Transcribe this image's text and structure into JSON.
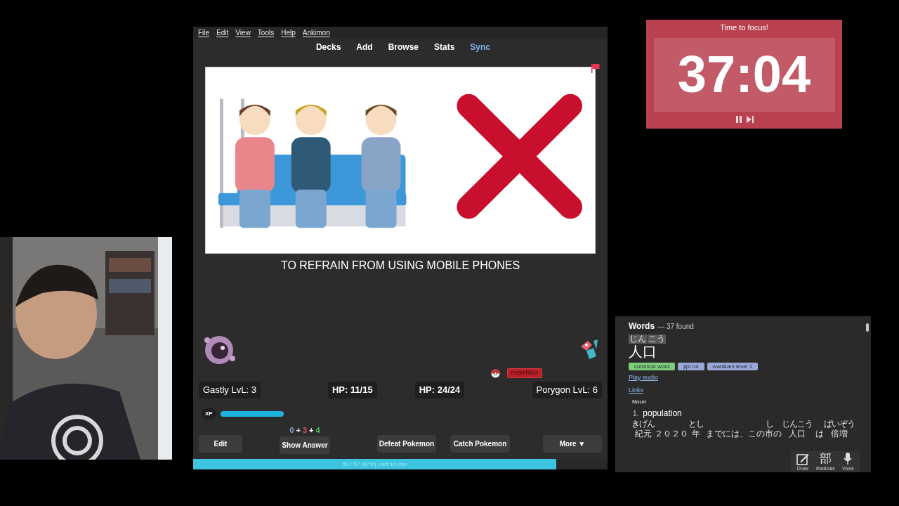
{
  "anki": {
    "menu": [
      "File",
      "Edit",
      "View",
      "Tools",
      "Help",
      "Ankimon"
    ],
    "toolbar": [
      {
        "label": "Decks",
        "highlighted": false
      },
      {
        "label": "Add",
        "highlighted": false
      },
      {
        "label": "Browse",
        "highlighted": false
      },
      {
        "label": "Stats",
        "highlighted": false
      },
      {
        "label": "Sync",
        "highlighted": true
      }
    ],
    "card": {
      "kind": "picture",
      "flagged": true,
      "answer": "TO REFRAIN FROM USING MOBILE PHONES"
    },
    "battle": {
      "player": {
        "name_level": "Gastly LvL: 3",
        "hp": "HP: 11/15"
      },
      "enemy": {
        "hp": "HP: 24/24",
        "name_level": "Porygon LvL: 6",
        "type": "FIGHTING"
      },
      "xp": {
        "label": "XP",
        "level": 0.3
      }
    },
    "counts": {
      "separator": "+",
      "items": [
        {
          "value": "0",
          "color": "#7fa6e0"
        },
        {
          "value": "3",
          "color": "#e0555a"
        },
        {
          "value": "4",
          "color": "#55c060"
        }
      ]
    },
    "buttons": [
      {
        "label": "Edit"
      },
      {
        "label": "Show Answer"
      },
      {
        "label": "Defeat Pokemon"
      },
      {
        "label": "Catch Pokemon"
      },
      {
        "label": "More ▼"
      }
    ],
    "progress": {
      "label": "50 / 57 (87%) | left 10 min",
      "level": 0.876
    }
  },
  "timer": {
    "title": "Time to focus!",
    "time": "37:04"
  },
  "dictionary": {
    "heading": "Words",
    "count": "— 37 found",
    "reading": [
      "じん",
      "こう"
    ],
    "word": "人口",
    "tags": [
      {
        "label": "common word",
        "color": "#7ccc78"
      },
      {
        "label": "jlpt n4",
        "color": "#9ba7d8"
      },
      {
        "label": "wanikani level 1",
        "color": "#9ba7d8"
      }
    ],
    "links": [
      "Play audio",
      "Links"
    ],
    "pos": "Noun",
    "sense_number": "1.",
    "gloss": "population",
    "example": [
      {
        "text": "紀元",
        "ruby": "きげん"
      },
      {
        "text": "２０２０"
      },
      {
        "text": "年",
        "ruby": "とし"
      },
      {
        "text": " までには、この"
      },
      {
        "text": "市",
        "ruby": "し"
      },
      {
        "text": "の"
      },
      {
        "text": "人口",
        "ruby": "じんこう"
      },
      {
        "text": " は"
      },
      {
        "text": "倍増",
        "ruby": "ばいぞう"
      }
    ],
    "tools": [
      {
        "kind": "draw",
        "label": "Draw"
      },
      {
        "kind": "radicals",
        "glyph": "部",
        "label": "Radicals"
      },
      {
        "kind": "voice",
        "label": "Voice"
      }
    ]
  }
}
